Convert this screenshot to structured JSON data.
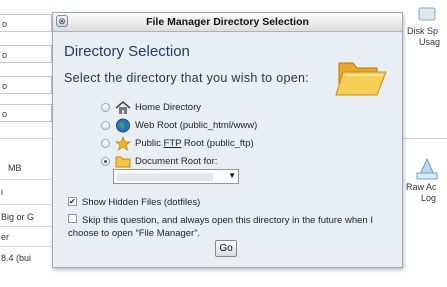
{
  "background": {
    "left_cells": [
      "o",
      "o",
      "o",
      "o"
    ],
    "left_texts": [
      "MB",
      "i",
      "Big or G",
      "er",
      "8.4 (bui"
    ],
    "right_top": [
      "Disk Sp",
      "Usag"
    ],
    "right_bottom": [
      "Raw Ac",
      "Log"
    ]
  },
  "dialog": {
    "title": "File Manager Directory Selection",
    "close_glyph": "⊗",
    "heading": "Directory Selection",
    "instruction": "Select the directory that you wish to open:",
    "options": [
      {
        "label": "Home Directory",
        "icon": "home-icon",
        "checked": false
      },
      {
        "label": "Web Root (public_html/www)",
        "icon": "globe-icon",
        "checked": false
      },
      {
        "label_pre": "Public ",
        "label_u": "FTP",
        "label_post": " Root (public_ftp)",
        "icon": "ftp-icon",
        "checked": false
      },
      {
        "label": "Document Root for:",
        "icon": "folder-icon",
        "checked": true
      }
    ],
    "domain_select": {
      "arrow": "▼"
    },
    "show_hidden": {
      "label": "Show Hidden Files (dotfiles)",
      "checked": true
    },
    "skip_question": {
      "label": "Skip this question, and always open this directory in the future when I choose to open “File Manager”.",
      "checked": false
    },
    "go_label": "Go"
  },
  "colors": {
    "accent": "#1f3f66",
    "dialog_bg": "#e9eef3",
    "folder": "#f5c542"
  }
}
